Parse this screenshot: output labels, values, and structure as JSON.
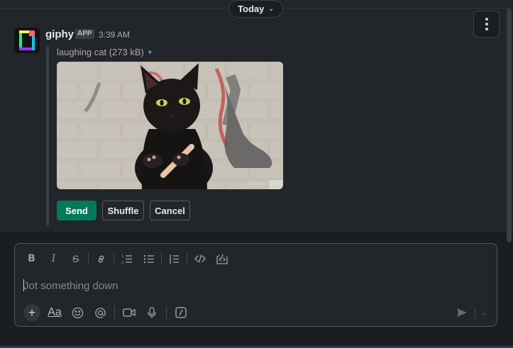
{
  "feed": {
    "date_divider": {
      "label": "Today"
    },
    "message": {
      "sender": "giphy",
      "badge": "APP",
      "time": "3:39 AM",
      "attachment": {
        "name": "laughing cat (273 kB)",
        "watermark": "Animate Lane"
      },
      "actions": {
        "send": "Send",
        "shuffle": "Shuffle",
        "cancel": "Cancel"
      }
    }
  },
  "composer": {
    "placeholder": "Jot something down",
    "toolbar": [
      "bold",
      "italic",
      "strikethrough",
      "link",
      "ordered-list",
      "bulleted-list",
      "blockquote",
      "code",
      "code-block"
    ],
    "bottom_actions": [
      "add",
      "formatting",
      "emoji",
      "mention",
      "video-clip",
      "audio-clip",
      "shortcuts"
    ],
    "formatting_label": "Aa"
  },
  "colors": {
    "background": "#1a1d21",
    "surface": "#222529",
    "accent_send": "#007a5a",
    "link": "#3e9ce0"
  }
}
